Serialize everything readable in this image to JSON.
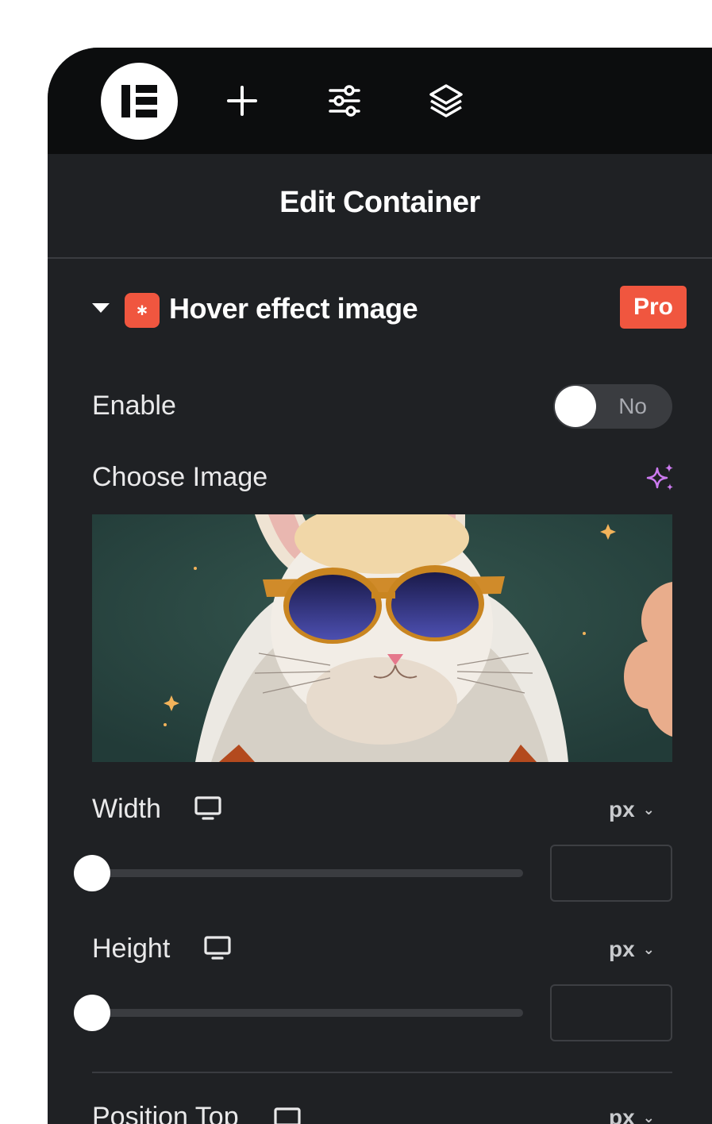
{
  "topbar": {
    "icons": [
      "elementor-logo-icon",
      "add-icon",
      "settings-sliders-icon",
      "layers-icon"
    ]
  },
  "header": {
    "title": "Edit Container"
  },
  "section": {
    "title": "Hover effect image",
    "badge": "Pro",
    "plugin_icon_glyph": "∗"
  },
  "enable": {
    "label": "Enable",
    "toggle_text": "No",
    "value": false
  },
  "choose_image": {
    "label": "Choose Image",
    "ai_icon": "ai-sparkle-icon"
  },
  "width": {
    "label": "Width",
    "unit": "px",
    "value": "",
    "slider_value": 0
  },
  "height": {
    "label": "Height",
    "unit": "px",
    "value": "",
    "slider_value": 0
  },
  "position_top": {
    "label": "Position Top",
    "unit": "px"
  },
  "colors": {
    "accent": "#f0563f",
    "panel": "#1f2124",
    "topbar": "#0c0d0e",
    "ai": "#cc7af0"
  }
}
